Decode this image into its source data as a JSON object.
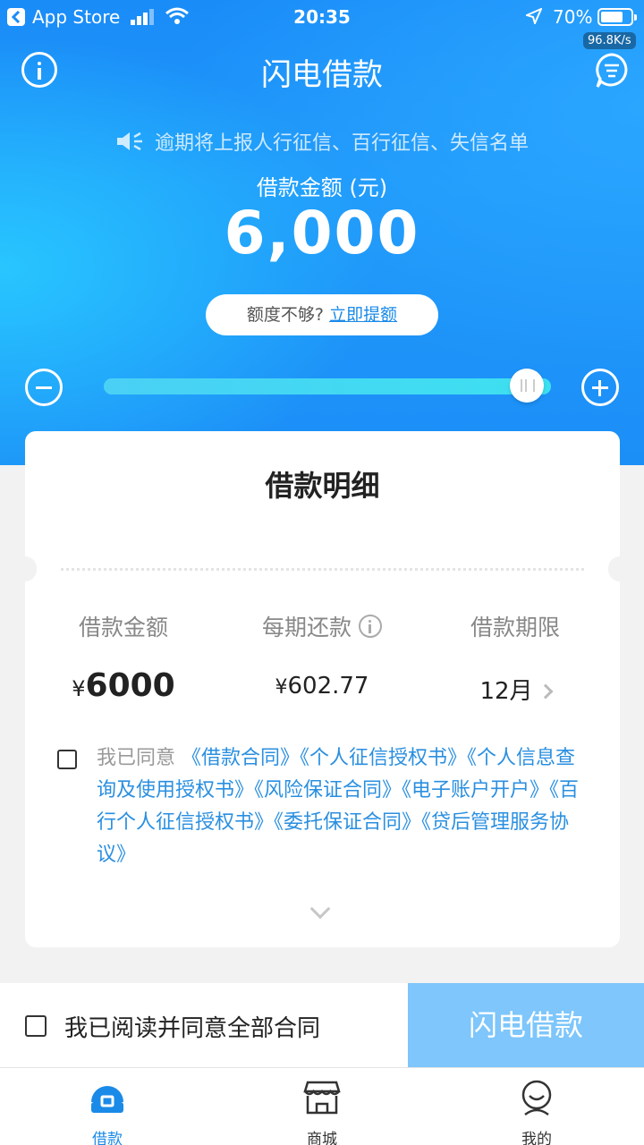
{
  "status_bar": {
    "carrier": "App Store",
    "time": "20:35",
    "battery": "70%",
    "net_speed": "96.8K/s"
  },
  "header": {
    "title": "闪电借款",
    "notice": "逾期将上报人行征信、百行征信、失信名单",
    "amount_label": "借款金额 (元)",
    "amount": "6,000",
    "raise_prefix": "额度不够?",
    "raise_link": "立即提额",
    "slider_level": 1.0
  },
  "detail": {
    "title": "借款明细",
    "columns": [
      {
        "label": "借款金额",
        "currency": "¥",
        "value": "6000"
      },
      {
        "label": "每期还款",
        "currency": "¥",
        "value": "602.77"
      },
      {
        "label": "借款期限",
        "value": "12月"
      }
    ],
    "agree_prefix": "我已同意",
    "documents": [
      "《借款合同》",
      "《个人征信授权书》",
      "《个人信息查询及使用授权书》",
      "《风险保证合同》",
      "《电子账户开户》",
      "《百行个人征信授权书》",
      "《委托保证合同》",
      "《贷后管理服务协议》"
    ]
  },
  "action_bar": {
    "agree_all": "我已阅读并同意全部合同",
    "submit": "闪电借款"
  },
  "tabbar": {
    "items": [
      {
        "label": "借款",
        "icon": "loan-icon",
        "active": true
      },
      {
        "label": "商城",
        "icon": "store-icon",
        "active": false
      },
      {
        "label": "我的",
        "icon": "profile-icon",
        "active": false
      }
    ]
  },
  "colors": {
    "brand_blue": "#1a8cf8",
    "link_blue": "#2a8fe0",
    "button_disabled": "#7ec6fb"
  }
}
